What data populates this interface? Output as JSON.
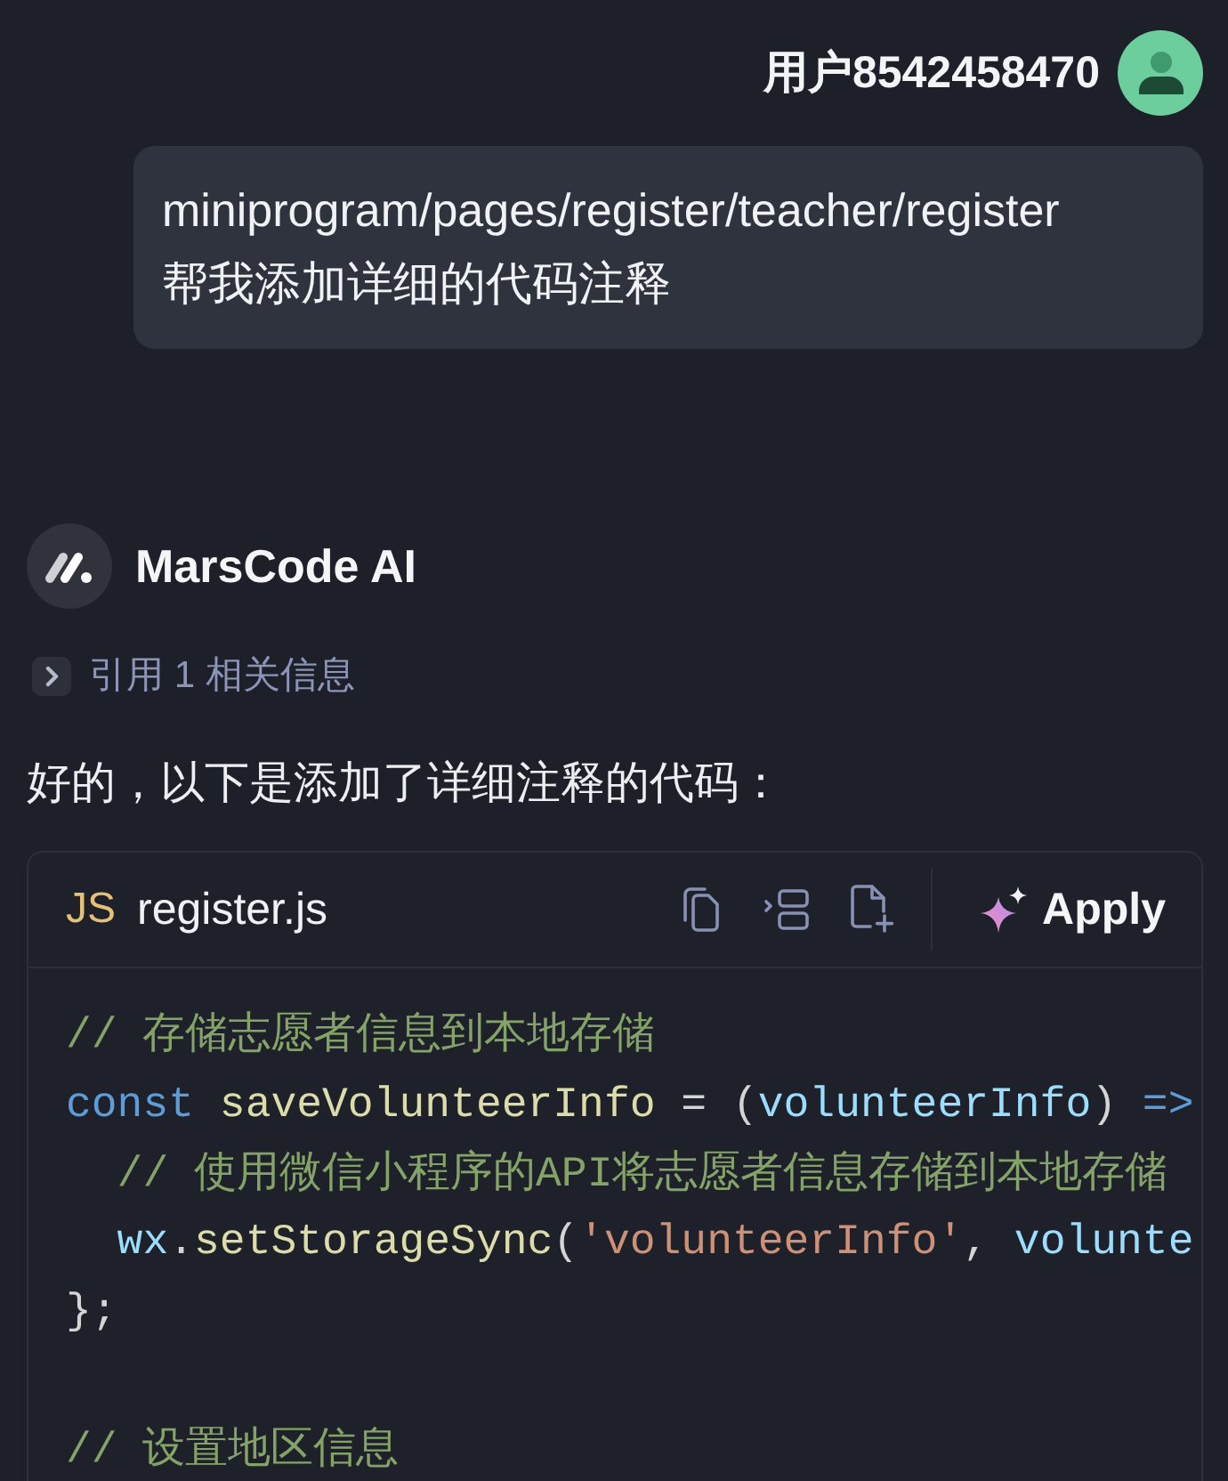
{
  "user_message": {
    "username": "用户8542458470",
    "lines": [
      "miniprogram/pages/register/teacher/register",
      "帮我添加详细的代码注释"
    ]
  },
  "assistant": {
    "name": "MarsCode AI",
    "references": {
      "label": "引用 1 相关信息",
      "expanded": false
    },
    "intro": "好的，以下是添加了详细注释的代码：",
    "code_block": {
      "language": "JS",
      "filename": "register.js",
      "apply_label": "Apply",
      "lines": [
        {
          "kind": "code",
          "tokens": [
            {
              "kind": "comment",
              "text": "// 存储志愿者信息到本地存储"
            }
          ]
        },
        {
          "kind": "code",
          "tokens": [
            {
              "kind": "keyword",
              "text": "const"
            },
            {
              "kind": "function",
              "text": " saveVolunteerInfo"
            },
            {
              "kind": "plain",
              "text": " = ("
            },
            {
              "kind": "variable",
              "text": "volunteerInfo"
            },
            {
              "kind": "plain",
              "text": ") "
            },
            {
              "kind": "keyword",
              "text": "=>"
            }
          ]
        },
        {
          "kind": "code",
          "tokens": [
            {
              "kind": "comment",
              "text": "  // 使用微信小程序的API将志愿者信息存储到本地存储"
            }
          ]
        },
        {
          "kind": "code",
          "tokens": [
            {
              "kind": "variable",
              "text": "  wx"
            },
            {
              "kind": "plain",
              "text": "."
            },
            {
              "kind": "function",
              "text": "setStorageSync"
            },
            {
              "kind": "plain",
              "text": "("
            },
            {
              "kind": "string",
              "text": "'volunteerInfo'"
            },
            {
              "kind": "plain",
              "text": ", "
            },
            {
              "kind": "variable",
              "text": "volunte"
            }
          ]
        },
        {
          "kind": "code",
          "tokens": [
            {
              "kind": "plain",
              "text": "};"
            }
          ]
        },
        {
          "kind": "blank"
        },
        {
          "kind": "code",
          "tokens": [
            {
              "kind": "comment",
              "text": "// 设置地区信息"
            }
          ]
        }
      ]
    }
  }
}
